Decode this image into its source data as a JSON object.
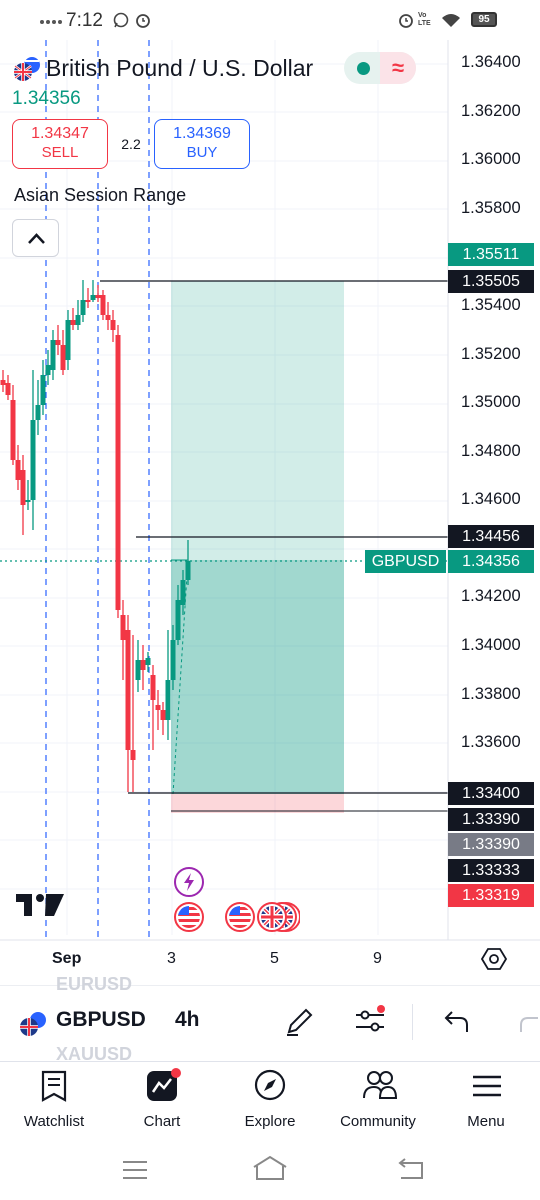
{
  "status_bar": {
    "time": "7:12",
    "battery": "95",
    "network": "Vo LTE"
  },
  "header": {
    "title": "British Pound / U.S. Dollar",
    "last_price": "1.34356",
    "sell": {
      "price": "1.34347",
      "label": "SELL"
    },
    "buy": {
      "price": "1.34369",
      "label": "BUY"
    },
    "spread": "2.2",
    "indicator": "Asian Session Range"
  },
  "colors": {
    "up": "#089981",
    "down": "#f23645",
    "accent": "#2962ff"
  },
  "price_axis": [
    "1.36400",
    "1.36200",
    "1.36000",
    "1.35800",
    "1.35400",
    "1.35200",
    "1.35000",
    "1.34800",
    "1.34600",
    "1.34200",
    "1.34000",
    "1.33800",
    "1.33600"
  ],
  "price_tags": [
    {
      "label": "1.35511",
      "color": "#089981"
    },
    {
      "label": "1.35505",
      "color": "#131722"
    },
    {
      "label": "1.34456",
      "color": "#131722"
    },
    {
      "label": "1.34356",
      "color": "#089981"
    },
    {
      "label": "1.33400",
      "color": "#131722"
    },
    {
      "label": "1.33390",
      "color": "#131722"
    },
    {
      "label": "1.33390",
      "color": "#787b86"
    },
    {
      "label": "1.33333",
      "color": "#131722"
    },
    {
      "label": "1.33319",
      "color": "#f23645"
    }
  ],
  "symbol_tag": "GBPUSD",
  "time_axis": [
    "Sep",
    "3",
    "5",
    "9"
  ],
  "toolbar": {
    "symbol": "GBPUSD",
    "symbol_prev": "EURUSD",
    "symbol_next": "XAUUSD",
    "interval": "4h"
  },
  "nav": [
    "Watchlist",
    "Chart",
    "Explore",
    "Community",
    "Menu"
  ]
}
